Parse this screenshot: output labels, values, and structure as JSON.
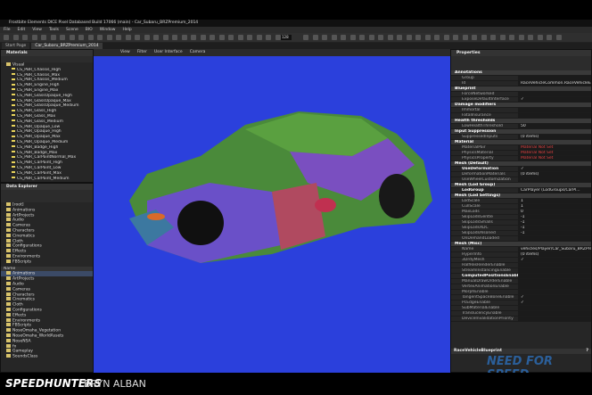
{
  "window": {
    "title": "Frostbite Elements DICE Pixel Databased Build 17066 (main) - Car_Subaru_BRZPremium_2014"
  },
  "menu": [
    "File",
    "Edit",
    "View",
    "Tools",
    "Scene",
    "BIO",
    "Window",
    "Help"
  ],
  "toolbar": {
    "zoom_value": "128"
  },
  "tabs": [
    "Start Page",
    "Car_Subaru_BRZPremium_2014"
  ],
  "materials": {
    "title": "Materials",
    "root": "Visual",
    "items": [
      "CS_PBR_Chassis_High",
      "CS_PBR_Chassis_Max",
      "CS_PBR_Chassis_Medium",
      "CS_PBR_Engine_High",
      "CS_PBR_Engine_Max",
      "CS_PBR_GlassOpaque_High",
      "CS_PBR_GlassOpaque_Max",
      "CS_PBR_GlassOpaque_Medium",
      "CS_PBR_Glass_High",
      "CS_PBR_Glass_Max",
      "CS_PBR_Glass_Medium",
      "CS_PBR_Opaque_Low",
      "CS_PBR_Opaque_High",
      "CS_PBR_Opaque_Max",
      "CS_PBR_Opaque_Medium",
      "CS_PBR_Badge_High",
      "CS_PBR_Badge_Max",
      "CS_PBR_CarPaintNormal_Max",
      "CS_PBR_CarPaint_High",
      "CS_PBR_CarPaint_Low",
      "CS_PBR_CarPaint_Max",
      "CS_PBR_CarPaint_Medium"
    ]
  },
  "data_explorer": {
    "title": "Data Explorer",
    "root": "[root]",
    "tree": [
      "Animations",
      "ArtProjects",
      "Audio",
      "Cameras",
      "Characters",
      "Cinematics",
      "Cloth",
      "Configurations",
      "Effects",
      "Environments",
      "FBScripts"
    ],
    "name_header": "Name",
    "list": [
      "Animations",
      "ArtProjects",
      "Audio",
      "Cameras",
      "Characters",
      "Cinematics",
      "Cloth",
      "Configurations",
      "Effects",
      "Environments",
      "FBScripts",
      "NoseOmaha_Vegetation",
      "NoseOmaha_WorldAssets",
      "NoseNSA",
      "fx",
      "Gameplay",
      "SoundsClass"
    ]
  },
  "viewport": {
    "menu": [
      "View",
      "Filter",
      "User Interface",
      "Camera"
    ],
    "bg": "#2b40dc"
  },
  "properties": {
    "title": "Properties",
    "rows": [
      {
        "cat": "Annotations"
      },
      {
        "k": "Group",
        "v": ""
      },
      {
        "k": "Id",
        "v": "RaceVehicleCommon.RaceVehicleEntity"
      },
      {
        "cat": "Blueprint"
      },
      {
        "k": "ForceNetworked",
        "v": ""
      },
      {
        "k": "ExposeDefaultInterface",
        "v": "✓"
      },
      {
        "cat": "Damage modifiers"
      },
      {
        "k": "Immortal",
        "v": ""
      },
      {
        "k": "FatalInsurance",
        "v": ""
      },
      {
        "cat": "Health thresholds"
      },
      {
        "k": "LowHealthThreshold",
        "v": "50"
      },
      {
        "cat": "Input Suppression"
      },
      {
        "k": "SuppressedInputs",
        "v": "(0 items)"
      },
      {
        "cat": "Material"
      },
      {
        "k": "MaterialPair",
        "v": "Material Not Set",
        "red": true
      },
      {
        "k": "PhysicsMaterial",
        "v": "Material Not Set",
        "red": true
      },
      {
        "k": "PhysicsProperty",
        "v": "Material Not Set",
        "red": true
      },
      {
        "cat": "Mesh (Default)"
      },
      {
        "k": "UseDeformation",
        "v": "✓",
        "bold": true
      },
      {
        "k": "DeformationMaterials",
        "v": "(0 items)"
      },
      {
        "k": "UseWheelCustomization",
        "v": ""
      },
      {
        "cat": "Mesh (Lod Group)"
      },
      {
        "k": "LodGroup",
        "v": "CarPlayer (LodGroups/CarPl...",
        "bold": true
      },
      {
        "cat": "Mesh (Lod Settings)"
      },
      {
        "k": "LodScale",
        "v": "1"
      },
      {
        "k": "CullScale",
        "v": "1"
      },
      {
        "k": "MaxLods",
        "v": "0"
      },
      {
        "k": "SkipLodsGentle",
        "v": "-1"
      },
      {
        "k": "SkipLodsSmalls",
        "v": "-1"
      },
      {
        "k": "SkipLodsXDC",
        "v": "-1"
      },
      {
        "k": "SkipLodsAlsoned",
        "v": "-1"
      },
      {
        "k": "OnDemandLoaded",
        "v": ""
      },
      {
        "cat": "Mesh (Misc)"
      },
      {
        "k": "Name",
        "v": "vehicles/Player/Car_Subaru_BRZPremium..."
      },
      {
        "k": "HyperInfo",
        "v": "(0 items)"
      },
      {
        "k": "3DrdyMesh",
        "v": "✓"
      },
      {
        "k": "HalfResRenderEnable",
        "v": ""
      },
      {
        "k": "StreamInstancingEnable",
        "v": ""
      },
      {
        "k": "ComputedPositionsEnable",
        "v": "",
        "bold": true
      },
      {
        "k": "ManualDrawOrderEnable",
        "v": ""
      },
      {
        "k": "VertexAnimationEnable",
        "v": ""
      },
      {
        "k": "MorphEnable",
        "v": ""
      },
      {
        "k": "TangentSpaceBoneEnable",
        "v": "✓"
      },
      {
        "k": "PcEdgeEnable",
        "v": "✓"
      },
      {
        "k": "SubMaterialEnable",
        "v": ""
      },
      {
        "k": "TranslucencyEnable",
        "v": ""
      },
      {
        "k": "DeviceInvalidationPriority",
        "v": ""
      }
    ],
    "footer": "RaceVehicleBlueprint",
    "help": "?"
  },
  "watermark": {
    "brand": "SPEEDHUNTERS",
    "author": "BRYN ALBAN",
    "logo": "NEED FOR SPEED"
  }
}
